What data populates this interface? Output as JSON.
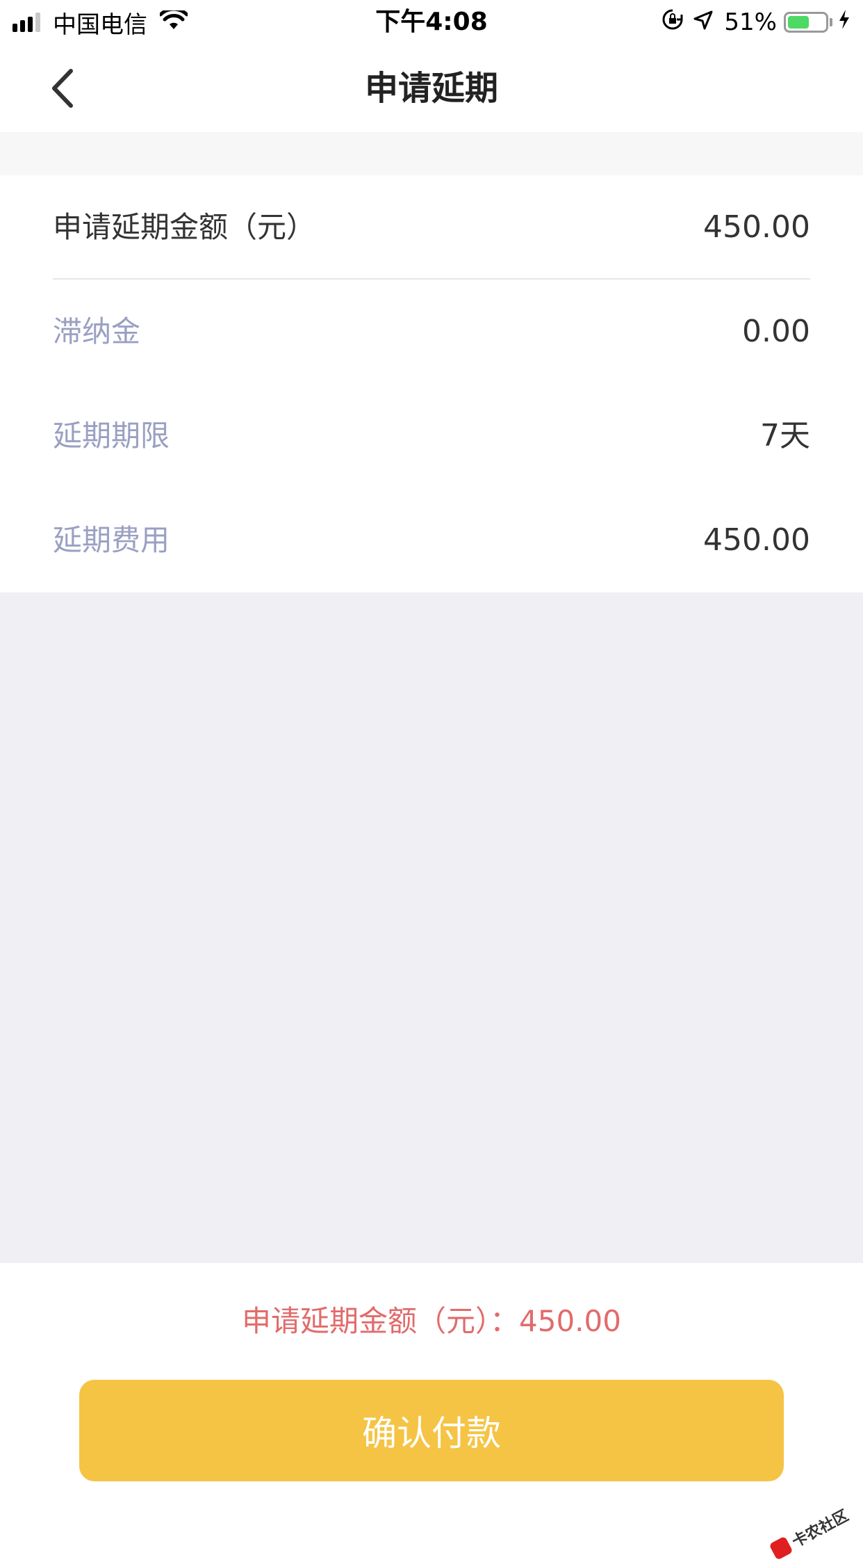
{
  "status_bar": {
    "carrier": "中国电信",
    "time": "下午4:08",
    "battery_percent": "51%"
  },
  "nav": {
    "title": "申请延期"
  },
  "details": {
    "amount_label": "申请延期金额（元）",
    "amount_value": "450.00",
    "late_fee_label": "滞纳金",
    "late_fee_value": "0.00",
    "term_label": "延期期限",
    "term_value": "7天",
    "fee_label": "延期费用",
    "fee_value": "450.00"
  },
  "footer": {
    "summary": "申请延期金额（元）：450.00",
    "confirm_label": "确认付款"
  },
  "watermark": {
    "text": "卡农社区"
  },
  "colors": {
    "accent": "#f5c445",
    "summary_text": "#e26b6b",
    "secondary_label": "#9aa0c2"
  }
}
